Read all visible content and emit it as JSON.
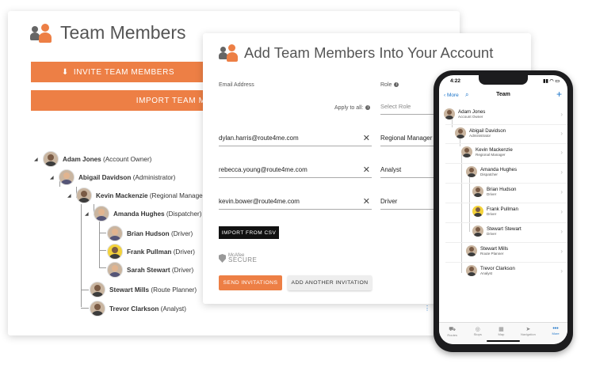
{
  "colors": {
    "accent": "#ed7f45",
    "link": "#1a73c8",
    "dark_button": "#111111"
  },
  "back_panel": {
    "title": "Team Members",
    "invite_button": "INVITE TEAM MEMBERS",
    "import_button": "IMPORT TEAM MEMB",
    "tree": [
      {
        "name": "Adam Jones",
        "role": "(Account Owner)"
      },
      {
        "name": "Abigail Davidson",
        "role": "(Administrator)"
      },
      {
        "name": "Kevin Mackenzie",
        "role": "(Regional Manager)"
      },
      {
        "name": "Amanda Hughes",
        "role": "(Dispatcher)"
      },
      {
        "name": "Brian Hudson",
        "role": "(Driver)"
      },
      {
        "name": "Frank Pullman",
        "role": "(Driver)"
      },
      {
        "name": "Sarah Stewart",
        "role": "(Driver)"
      },
      {
        "name": "Stewart Mills",
        "role": "(Route Planner)"
      },
      {
        "name": "Trevor Clarkson",
        "role": "(Analyst)"
      }
    ]
  },
  "add_panel": {
    "title": "Add Team Members Into Your Account",
    "email_label": "Email Address",
    "role_label": "Role",
    "apply_to_all": "Apply to all:",
    "select_role_placeholder": "Select Role",
    "rows": [
      {
        "email": "dylan.harris@route4me.com",
        "role": "Regional Manager"
      },
      {
        "email": "rebecca.young@route4me.com",
        "role": "Analyst"
      },
      {
        "email": "kevin.bower@route4me.com",
        "role": "Driver"
      }
    ],
    "clear_icon": "✕",
    "import_csv_button": "IMPORT FROM CSV",
    "mcafee_small": "McAfee",
    "mcafee_big": "SECURE",
    "send_button": "SEND INVITATIONS",
    "add_another_button": "ADD ANOTHER INVITATION"
  },
  "phone": {
    "time": "4:22",
    "back_label": "More",
    "title": "Team",
    "plus": "+",
    "members": [
      {
        "name": "Adam Jones",
        "role": "Account Owner"
      },
      {
        "name": "Abigail Davidson",
        "role": "Administrator"
      },
      {
        "name": "Kevin Mackenzie",
        "role": "Regional Manager"
      },
      {
        "name": "Amanda Hughes",
        "role": "Dispatcher"
      },
      {
        "name": "Brian Hudson",
        "role": "Driver"
      },
      {
        "name": "Frank Pullman",
        "role": "Driver"
      },
      {
        "name": "Stewart Stewart",
        "role": "Driver"
      },
      {
        "name": "Stewart Mills",
        "role": "Route Planner"
      },
      {
        "name": "Trevor Clarkson",
        "role": "Analyst"
      }
    ],
    "tabs": [
      {
        "label": "Routes",
        "icon": "routes-icon"
      },
      {
        "label": "Stops",
        "icon": "stops-icon"
      },
      {
        "label": "Map",
        "icon": "map-icon"
      },
      {
        "label": "Navigation",
        "icon": "navigation-icon"
      },
      {
        "label": "More",
        "icon": "more-icon"
      }
    ]
  }
}
